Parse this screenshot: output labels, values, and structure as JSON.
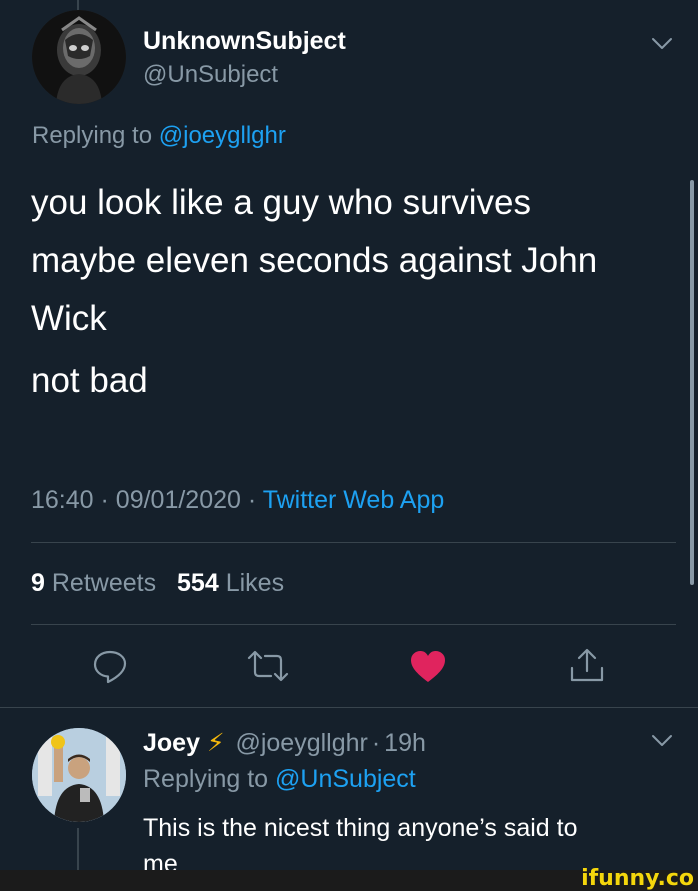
{
  "main_tweet": {
    "display_name": "UnknownSubject",
    "handle": "@UnSubject",
    "replying_prefix": "Replying to",
    "replying_handle": "@joeygllghr",
    "text_line1": "you look like a guy who survives",
    "text_line2": "maybe eleven seconds against John",
    "text_line3": "Wick",
    "text_line4": "not bad",
    "time": "16:40",
    "date": "09/01/2020",
    "separator": "·",
    "client": "Twitter Web App",
    "retweet_count": "9",
    "retweet_label": "Retweets",
    "like_count": "554",
    "like_label": "Likes",
    "liked": true
  },
  "reply_tweet": {
    "display_name": "Joey",
    "emoji": "⚡",
    "handle": "@joeygllghr",
    "separator": "·",
    "age": "19h",
    "replying_prefix": "Replying to",
    "replying_handle": "@UnSubject",
    "text_line1": "This is the nicest thing anyone’s said to",
    "text_line2": "me"
  },
  "watermark": "ifunny.co",
  "icons": {
    "reply": "speech-bubble-icon",
    "retweet": "retweet-arrows-icon",
    "like": "heart-icon",
    "share": "share-upload-icon",
    "more": "chevron-down-icon"
  },
  "colors": {
    "background": "#15202b",
    "link": "#1da1f2",
    "muted": "#8899a6",
    "like": "#e0245e",
    "divider": "#38444d"
  }
}
